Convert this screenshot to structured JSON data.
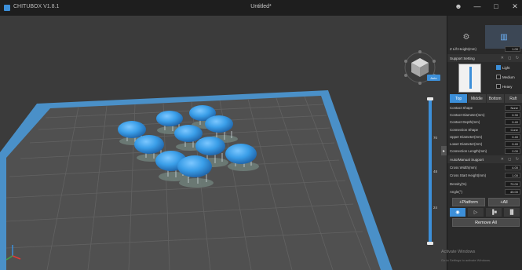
{
  "titlebar": {
    "app_name": "CHITUBOX V1.8.1",
    "doc_title": "Untitled*",
    "user_icon": "user-icon",
    "min_icon": "minimize-icon",
    "max_icon": "maximize-icon",
    "close_icon": "close-icon"
  },
  "viewport": {
    "auto_label": "Auto",
    "slider_labels": [
      "70",
      "48",
      "24"
    ],
    "axis_colors": {
      "x": "#e53935",
      "y": "#43a047",
      "z": "#3c8fd9"
    }
  },
  "panel": {
    "tabs": [
      "⚙",
      "▥"
    ],
    "lift_height": {
      "label": "Z Lift Height(mm)",
      "value": "1.00"
    },
    "support_setting": {
      "label": "Support Setting"
    },
    "density_options": [
      {
        "label": "Light",
        "checked": true
      },
      {
        "label": "Medium",
        "checked": false
      },
      {
        "label": "Heavy",
        "checked": false
      }
    ],
    "support_tabs": [
      "Top",
      "Middle",
      "Bottom",
      "Raft"
    ],
    "top_fields": [
      {
        "label": "Contact Shape",
        "value": "None"
      },
      {
        "label": "Contact Diameter(mm)",
        "value": "0.30"
      },
      {
        "label": "Contact Depth(mm)",
        "value": "0.40"
      },
      {
        "label": "Connection Shape",
        "value": "Cone"
      },
      {
        "label": "Upper Diameter(mm)",
        "value": "0.40"
      },
      {
        "label": "Lower Diameter(mm)",
        "value": "0.40"
      },
      {
        "label": "Connection Length(mm)",
        "value": "2.00"
      }
    ],
    "auto_manual": {
      "label": "Auto/Manual Support"
    },
    "auto_fields": [
      {
        "label": "Cross Width(mm)",
        "value": "4.00"
      },
      {
        "label": "Cross Start Height(mm)",
        "value": "1.00"
      },
      {
        "label": "Density(%)",
        "value": "70.00"
      },
      {
        "label": "Angle(°)",
        "value": "45.00"
      }
    ],
    "platform_btn": "+Platform",
    "all_btn": "+All",
    "tool_icons": [
      "eye-icon",
      "pointer-icon",
      "add-support-icon",
      "line-support-icon"
    ],
    "tool_glyphs": [
      "◉",
      "▷",
      "▐■",
      "▐▌"
    ],
    "remove_all_btn": "Remove All"
  },
  "watermark": {
    "title": "Activate Windows",
    "subtitle": "Go to Settings to activate Windows."
  },
  "colors": {
    "accent": "#3c8fd9",
    "model": "#3a9ee8",
    "plate_border": "#4a90c8",
    "grid": "#555555"
  }
}
